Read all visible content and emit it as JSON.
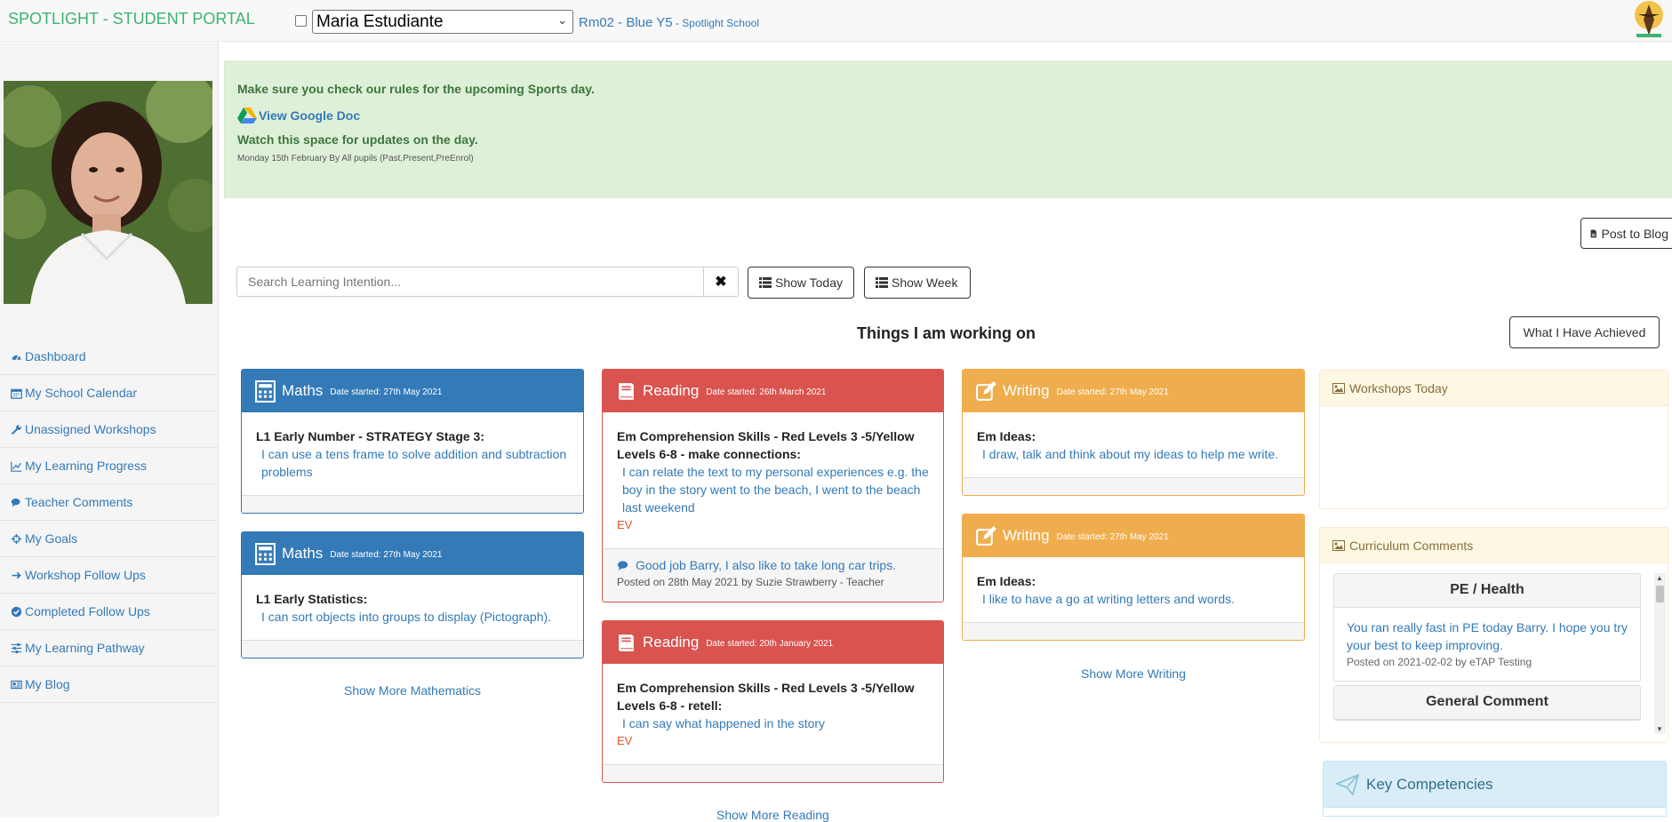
{
  "header": {
    "brand": "SPOTLIGHT - STUDENT PORTAL",
    "student_select": "Maria Estudiante",
    "room": "Rm02 - Blue Y5",
    "school": " - Spotlight School"
  },
  "sidebar": {
    "items": [
      {
        "label": "Dashboard",
        "icon": "dashboard-icon"
      },
      {
        "label": "My School Calendar",
        "icon": "calendar-icon"
      },
      {
        "label": "Unassigned Workshops",
        "icon": "wrench-icon"
      },
      {
        "label": "My Learning Progress",
        "icon": "line-chart-icon"
      },
      {
        "label": "Teacher Comments",
        "icon": "comments-icon"
      },
      {
        "label": "My Goals",
        "icon": "crosshairs-icon"
      },
      {
        "label": "Workshop Follow Ups",
        "icon": "arrow-right-icon"
      },
      {
        "label": "Completed Follow Ups",
        "icon": "check-circle-icon"
      },
      {
        "label": "My Learning Pathway",
        "icon": "sliders-icon"
      },
      {
        "label": "My Blog",
        "icon": "newspaper-icon"
      }
    ]
  },
  "notice": {
    "line1": "Make sure you check our rules for the upcoming Sports day.",
    "doc_link": "View Google Doc",
    "line2": "Watch this space for updates on the day.",
    "meta": "Monday 15th February By All pupils (Past,Present,PreEnrol)"
  },
  "toolbar": {
    "post_blog": "Post to Blog",
    "search_placeholder": "Search Learning Intention...",
    "clear": "✖",
    "show_today": "Show Today",
    "show_week": "Show Week",
    "achieved": "What I Have Achieved"
  },
  "main": {
    "heading": "Things I am working on",
    "cards": {
      "maths1": {
        "subject": "Maths",
        "date": "Date started: 27th May 2021",
        "li": "L1 Early Number - STRATEGY Stage 3:",
        "sc": "I can use a tens frame to solve addition and subtraction problems"
      },
      "maths2": {
        "subject": "Maths",
        "date": "Date started: 27th May 2021",
        "li": "L1 Early Statistics:",
        "sc": "I can sort objects into groups to display (Pictograph)."
      },
      "reading1": {
        "subject": "Reading",
        "date": "Date started: 26th March 2021",
        "li": "Em Comprehension Skills - Red Levels 3 -5/Yellow Levels 6-8 - make connections:",
        "sc": "I can relate the text to my personal experiences e.g. the boy in the story went to the beach, I went to the beach last weekend",
        "ev": "EV",
        "comment": "Good job Barry, I also like to take long car trips.",
        "comment_by": "Posted on 28th May 2021 by Suzie Strawberry - Teacher"
      },
      "reading2": {
        "subject": "Reading",
        "date": "Date started: 20th January 2021",
        "li": "Em Comprehension Skills - Red Levels 3 -5/Yellow Levels 6-8 - retell:",
        "sc": "I can say what happened in the story",
        "ev": "EV"
      },
      "writing1": {
        "subject": "Writing",
        "date": "Date started: 27th May 2021",
        "li": "Em Ideas:",
        "sc": "I draw, talk and think about my ideas to help me write."
      },
      "writing2": {
        "subject": "Writing",
        "date": "Date started: 27th May 2021",
        "li": "Em Ideas:",
        "sc": "I like to have a go at writing letters and words."
      }
    },
    "more_maths": "Show More Mathematics",
    "more_reading": "Show More Reading",
    "more_writing": "Show More Writing"
  },
  "right": {
    "workshops_title": "Workshops Today",
    "curriculum_title": "Curriculum Comments",
    "curriculum_items": [
      {
        "title": "PE / Health",
        "text": "You ran really fast in PE today Barry. I hope you try your best to keep improving.",
        "by": "Posted on 2021-02-02 by eTAP Testing"
      },
      {
        "title": "General Comment",
        "text": "",
        "by": ""
      }
    ],
    "key_competencies": "Key Competencies"
  },
  "colors": {
    "maths": "#337ab7",
    "reading": "#d9534f",
    "writing": "#f0ad4e",
    "notice_bg": "#dff0d8",
    "brand": "#3cb371"
  }
}
